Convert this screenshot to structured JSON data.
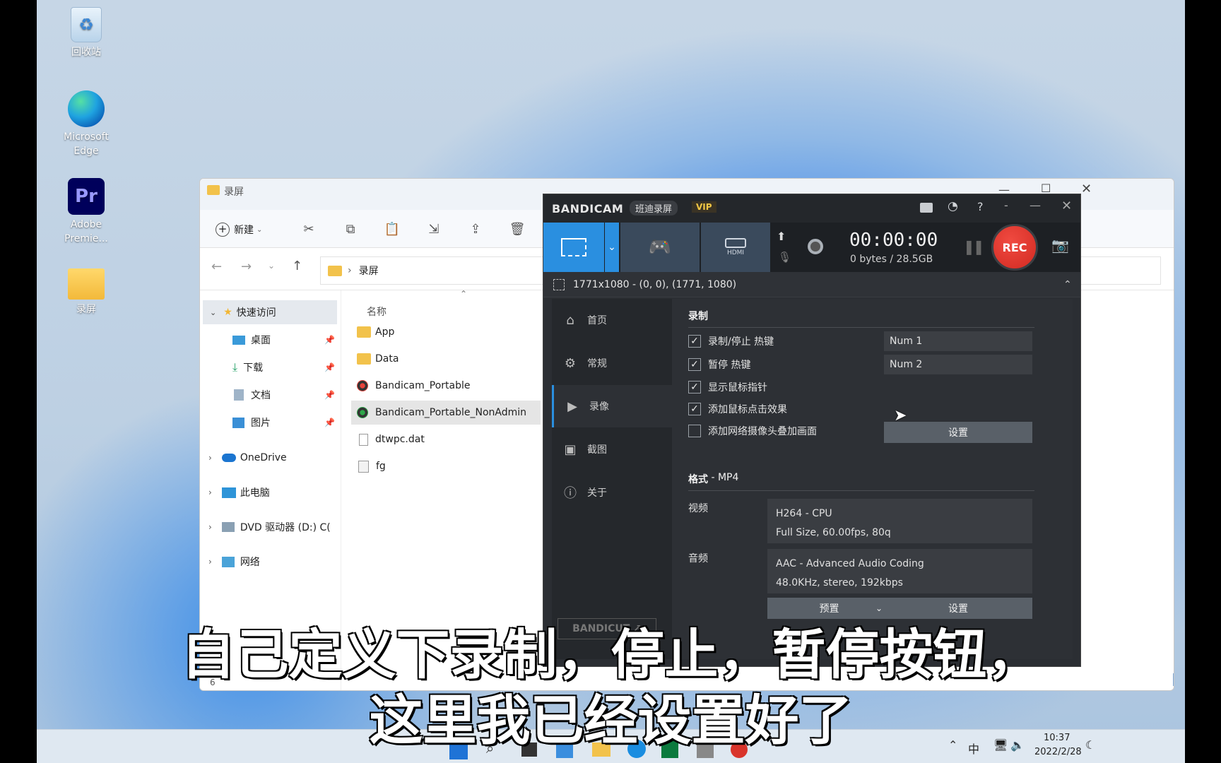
{
  "desktop": {
    "icons": [
      {
        "label": "回收站",
        "icon": "recycle-bin-icon"
      },
      {
        "label": "Microsoft Edge",
        "icon": "edge-icon"
      },
      {
        "label": "Adobe Premie...",
        "icon": "premiere-icon"
      },
      {
        "label": "录屏",
        "icon": "folder-icon"
      }
    ]
  },
  "explorer": {
    "title": "录屏",
    "toolbar": {
      "new_label": "新建"
    },
    "breadcrumb": "录屏",
    "column_name": "名称",
    "nav": [
      {
        "label": "快速访问",
        "icon": "star-icon"
      },
      {
        "label": "桌面",
        "icon": "desktop-icon"
      },
      {
        "label": "下载",
        "icon": "download-icon"
      },
      {
        "label": "文档",
        "icon": "document-icon"
      },
      {
        "label": "图片",
        "icon": "picture-icon"
      },
      {
        "label": "OneDrive",
        "icon": "cloud-icon"
      },
      {
        "label": "此电脑",
        "icon": "computer-icon"
      },
      {
        "label": "DVD 驱动器 (D:) C(",
        "icon": "dvd-icon"
      },
      {
        "label": "网络",
        "icon": "network-icon"
      }
    ],
    "files": [
      {
        "name": "App",
        "type": "folder"
      },
      {
        "name": "Data",
        "type": "folder"
      },
      {
        "name": "Bandicam_Portable",
        "type": "app"
      },
      {
        "name": "Bandicam_Portable_NonAdmin",
        "type": "app",
        "selected": true
      },
      {
        "name": "dtwpc.dat",
        "type": "file"
      },
      {
        "name": "fg",
        "type": "file"
      }
    ],
    "status_count": "6"
  },
  "bandicam": {
    "brand": "BANDICAM",
    "tag_cn": "班迪录屏",
    "vip": "VIP",
    "timer": "00:00:00",
    "size": "0 bytes / 28.5GB",
    "rec_label": "REC",
    "area": "1771x1080 - (0, 0), (1771, 1080)",
    "hdmi_label": "HDMI",
    "sidebar": [
      {
        "label": "首页",
        "icon": "home-icon"
      },
      {
        "label": "常规",
        "icon": "gear-icon"
      },
      {
        "label": "录像",
        "icon": "video-icon",
        "active": true
      },
      {
        "label": "截图",
        "icon": "image-icon"
      },
      {
        "label": "关于",
        "icon": "info-icon"
      }
    ],
    "bandicut_label": "BANDICUT ↗",
    "record_section": "录制",
    "options": [
      {
        "label": "录制/停止 热键",
        "checked": true,
        "hotkey": "Num 1"
      },
      {
        "label": "暂停 热键",
        "checked": true,
        "hotkey": "Num 2"
      },
      {
        "label": "显示鼠标指针",
        "checked": true
      },
      {
        "label": "添加鼠标点击效果",
        "checked": true
      },
      {
        "label": "添加网络摄像头叠加画面",
        "checked": false
      }
    ],
    "settings_label": "设置",
    "format_label": "格式",
    "format_value": " - MP4",
    "video_label": "视频",
    "video_line1": "H264 - CPU",
    "video_line2": "Full Size, 60.00fps, 80q",
    "audio_label": "音频",
    "audio_line1": "AAC - Advanced Audio Coding",
    "audio_line2": "48.0KHz, stereo, 192kbps",
    "preset_label": "预置",
    "settings2_label": "设置"
  },
  "subtitles": {
    "line1": "自己定义下录制，停止，暂停按钮，",
    "line2": "这里我已经设置好了"
  },
  "taskbar": {
    "ime": "中",
    "time": "10:37",
    "date": "2022/2/28"
  }
}
